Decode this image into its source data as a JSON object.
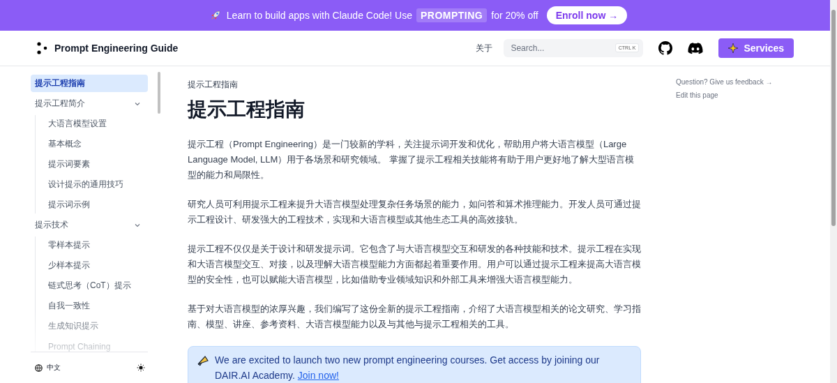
{
  "banner": {
    "text_before": "Learn to build apps with Claude Code! Use",
    "code": "PROMPTING",
    "text_after": "for 20% off",
    "button": "Enroll now →"
  },
  "header": {
    "logo": "Prompt Engineering Guide",
    "nav_link": "关于",
    "search": {
      "placeholder": "Search...",
      "shortcut": "CTRL K"
    },
    "services_button": "Services"
  },
  "sidebar": {
    "items": [
      {
        "label": "提示工程指南",
        "selected": true
      },
      {
        "label": "提示工程简介",
        "selected": false,
        "expanded": true,
        "children": [
          {
            "label": "大语言模型设置",
            "selected": false
          },
          {
            "label": "基本概念",
            "selected": false
          },
          {
            "label": "提示词要素",
            "selected": false
          },
          {
            "label": "设计提示的通用技巧",
            "selected": false
          },
          {
            "label": "提示词示例",
            "selected": false
          }
        ]
      },
      {
        "label": "提示技术",
        "selected": false,
        "expanded": true,
        "children": [
          {
            "label": "零样本提示",
            "selected": false
          },
          {
            "label": "少样本提示",
            "selected": false
          },
          {
            "label": "链式思考（CoT）提示",
            "selected": false
          },
          {
            "label": "自我一致性",
            "selected": false
          },
          {
            "label": "生成知识提示",
            "selected": false
          },
          {
            "label": "Prompt Chaining",
            "selected": false
          }
        ]
      }
    ],
    "language": "中文"
  },
  "breadcrumb": "提示工程指南",
  "title": "提示工程指南",
  "paragraphs": [
    "提示工程（Prompt Engineering）是一门较新的学科，关注提示词开发和优化，帮助用户将大语言模型（Large Language Model, LLM）用于各场景和研究领域。 掌握了提示工程相关技能将有助于用户更好地了解大型语言模型的能力和局限性。",
    "研究人员可利用提示工程来提升大语言模型处理复杂任务场景的能力，如问答和算术推理能力。开发人员可通过提示工程设计、研发强大的工程技术，实现和大语言模型或其他生态工具的高效接轨。",
    "提示工程不仅仅是关于设计和研发提示词。它包含了与大语言模型交互和研发的各种技能和技术。提示工程在实现和大语言模型交互、对接，以及理解大语言模型能力方面都起着重要作用。用户可以通过提示工程来提高大语言模型的安全性，也可以赋能大语言模型，比如借助专业领域知识和外部工具来增强大语言模型能力。",
    "基于对大语言模型的浓厚兴趣，我们编写了这份全新的提示工程指南，介绍了大语言模型相关的论文研究、学习指南、模型、讲座、参考资料、大语言模型能力以及与其他与提示工程相关的工具。"
  ],
  "callout": {
    "text": "We are excited to launch two new prompt engineering courses. Get access by joining our DAIR.AI Academy.",
    "link": "Join now!"
  },
  "toc_links": [
    "Question? Give us feedback →",
    "Edit this page"
  ]
}
